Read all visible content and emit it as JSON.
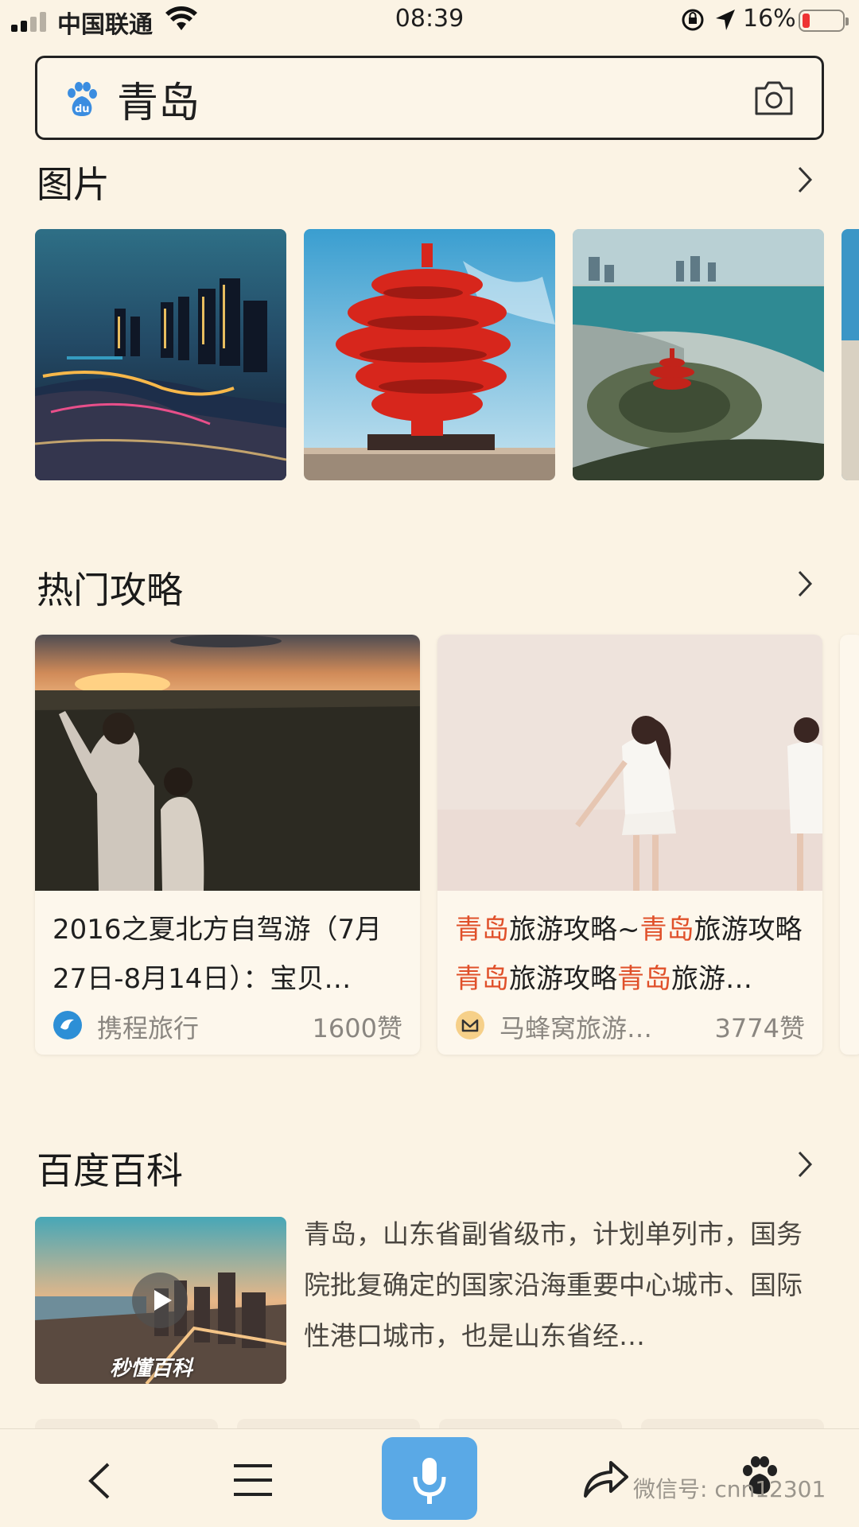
{
  "status_bar": {
    "carrier": "中国联通",
    "time": "08:39",
    "battery_percent": "16%",
    "battery_level": 0.16
  },
  "search": {
    "query": "青岛",
    "placeholder": ""
  },
  "images_section": {
    "title": "图片",
    "images": [
      "qingdao-night-skyline",
      "may-fourth-square-sculpture",
      "coastal-plaza-aerial"
    ]
  },
  "guides_section": {
    "title": "热门攻略",
    "cards": [
      {
        "title_parts": [
          {
            "text": "2016之夏北方自驾游（7月27日-8月14日）：宝贝…",
            "highlight": false
          }
        ],
        "source": "携程旅行",
        "likes": "1600赞",
        "source_icon": "ctrip-icon"
      },
      {
        "title_parts": [
          {
            "text": "青岛",
            "highlight": true
          },
          {
            "text": "旅游攻略~",
            "highlight": false
          },
          {
            "text": "青岛",
            "highlight": true
          },
          {
            "text": "旅游攻略",
            "highlight": false
          },
          {
            "text": "青岛",
            "highlight": true
          },
          {
            "text": "旅游攻略",
            "highlight": false
          },
          {
            "text": "青岛",
            "highlight": true
          },
          {
            "text": "旅游…",
            "highlight": false
          }
        ],
        "source": "马蜂窝旅游…",
        "likes": "3774赞",
        "source_icon": "mafengwo-icon"
      }
    ]
  },
  "baike_section": {
    "title": "百度百科",
    "summary": "青岛，山东省副省级市，计划单列市，国务院批复确定的国家沿海重要中心城市、国际性港口城市，也是山东省经…",
    "video_logo": "秒懂百科"
  },
  "bottom_nav": {
    "watermark": "微信号: cnn12301"
  },
  "colors": {
    "background": "#fbf3e4",
    "highlight": "#e0502a",
    "mic_button": "#5aa9e6",
    "text_secondary": "#8a8680"
  }
}
